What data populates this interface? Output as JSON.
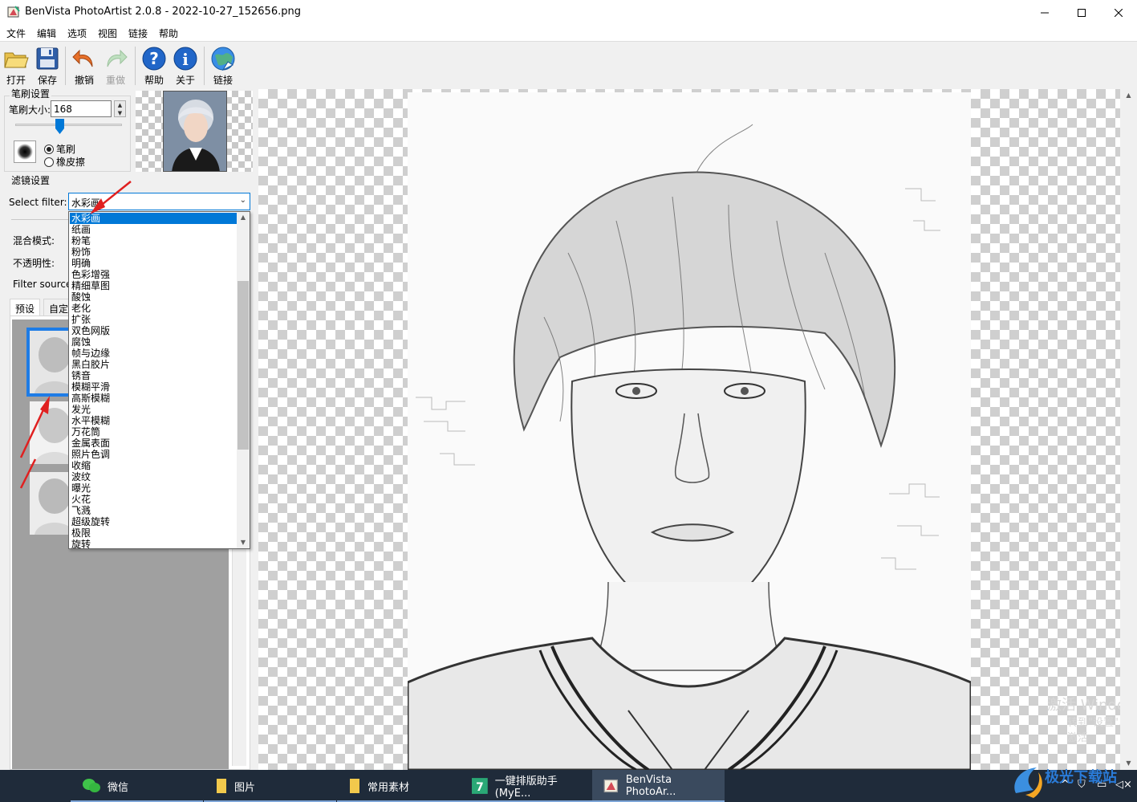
{
  "window": {
    "title": "BenVista PhotoArtist 2.0.8 - 2022-10-27_152656.png",
    "minimize_icon": "minimize-icon",
    "maximize_icon": "maximize-icon",
    "close_icon": "close-icon"
  },
  "menu": [
    "文件",
    "编辑",
    "选项",
    "视图",
    "链接",
    "帮助"
  ],
  "toolbar": {
    "open": "打开",
    "save": "保存",
    "undo": "撤销",
    "redo": "重做",
    "help": "帮助",
    "about": "关于",
    "link": "链接"
  },
  "brush": {
    "group_title": "笔刷设置",
    "size_label": "笔刷大小:",
    "size_value": "168",
    "slider_fraction": 0.42,
    "mode_brush": "笔刷",
    "mode_eraser": "橡皮擦",
    "selected_mode": "笔刷"
  },
  "filter": {
    "group_title": "滤镜设置",
    "select_label": "Select filter:",
    "selected": "水彩画",
    "blend_label": "混合模式:",
    "opacity_label": "不透明性:",
    "source_label": "Filter source:",
    "tab_presets": "预设",
    "tab_custom": "自定",
    "options": [
      "水彩画",
      "纸画",
      "粉笔",
      "粉饰",
      "明确",
      "色彩增强",
      "精细草图",
      "酸蚀",
      "老化",
      "扩张",
      "双色网版",
      "腐蚀",
      "帧与边缘",
      "黑白胶片",
      "锈音",
      "模糊平滑",
      "高斯模糊",
      "发光",
      "水平模糊",
      "万花筒",
      "金属表面",
      "照片色调",
      "收缩",
      "波纹",
      "曝光",
      "火花",
      "飞溅",
      "超级旋转",
      "极限",
      "旋转"
    ]
  },
  "watermark": {
    "line1": "激活 Windo",
    "line2": "转到\"设置\"以激活"
  },
  "taskbar": {
    "items": [
      "微信",
      "图片",
      "常用素材",
      "一键排版助手(MyE...",
      "BenVista PhotoAr..."
    ],
    "site_logo": "极光下载站"
  },
  "colors": {
    "accent": "#0078d7",
    "selection_blue": "#1e7ce6",
    "annotation_red": "#e02020",
    "taskbar": "#1f2b3a"
  }
}
